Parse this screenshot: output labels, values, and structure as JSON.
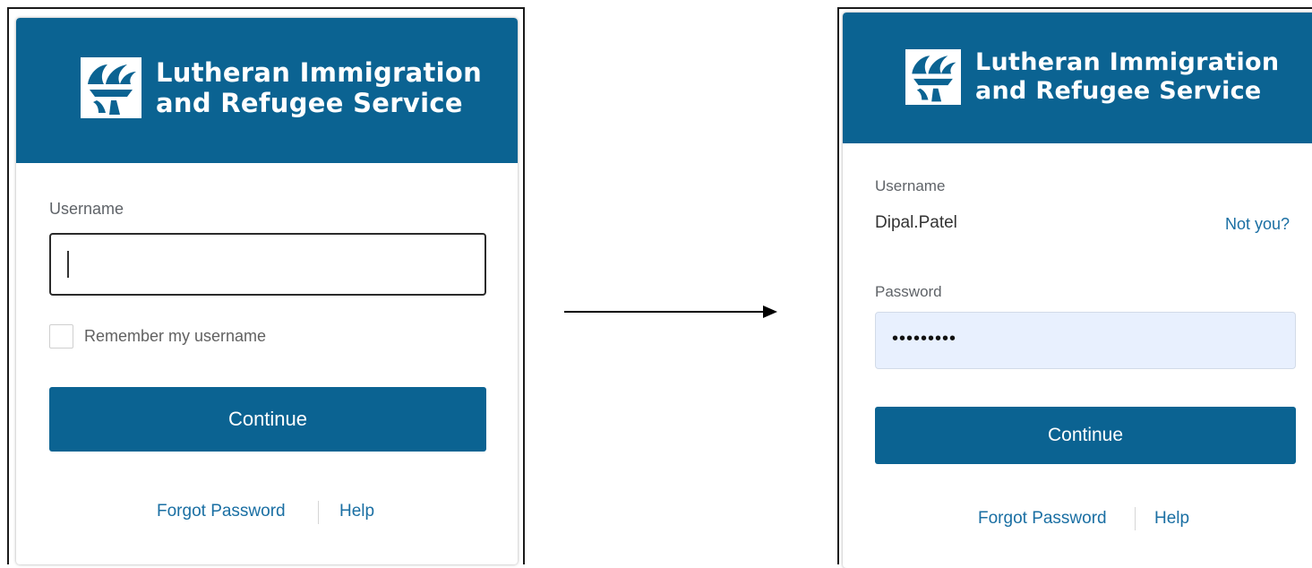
{
  "colors": {
    "brand_blue": "#0b6392",
    "link_blue": "#1a6fa3",
    "password_fill": "#e8f0fe"
  },
  "left_panel": {
    "brand_line1": "Lutheran Immigration",
    "brand_line2": "and Refugee Service",
    "logo_icon": "torch-logo-icon",
    "username_label": "Username",
    "username_value": "",
    "remember_label": "Remember my username",
    "remember_checked": false,
    "continue_label": "Continue",
    "forgot_password": "Forgot Password",
    "help": "Help"
  },
  "arrow_icon": "arrow-right-icon",
  "right_panel": {
    "brand_line1": "Lutheran Immigration",
    "brand_line2": "and Refugee Service",
    "logo_icon": "torch-logo-icon",
    "username_label": "Username",
    "username_value": "Dipal.Patel",
    "not_you": "Not you?",
    "password_label": "Password",
    "password_value": "•••••••••",
    "continue_label": "Continue",
    "forgot_password": "Forgot Password",
    "help": "Help"
  }
}
